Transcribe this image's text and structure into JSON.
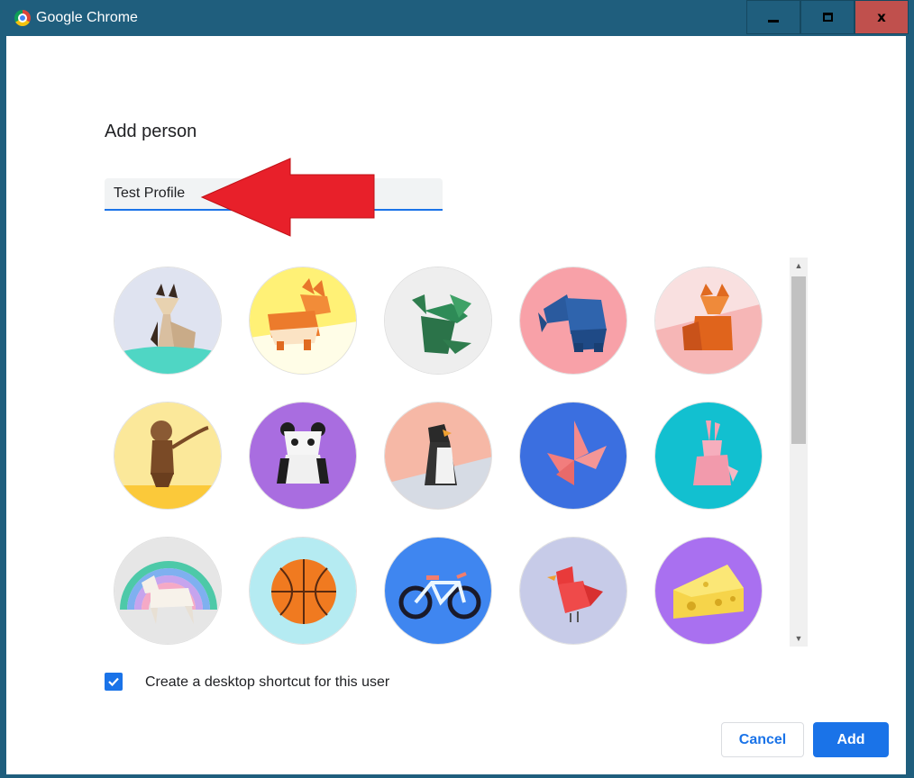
{
  "window": {
    "title": "Google Chrome",
    "icon": "chrome-icon",
    "controls": {
      "minimize": "minimize-icon",
      "maximize": "maximize-icon",
      "close_glyph": "x"
    }
  },
  "dialog": {
    "title": "Add person",
    "name_input_value": "Test Profile",
    "annotation": "red-arrow-pointing-left",
    "avatars": [
      {
        "name": "cat",
        "bg": "#dfe3f0"
      },
      {
        "name": "corgi",
        "bg": "#fff176"
      },
      {
        "name": "dragon",
        "bg": "#eeeeee"
      },
      {
        "name": "elephant",
        "bg": "#f8a1a8"
      },
      {
        "name": "fox",
        "bg": "#f9e0e0"
      },
      {
        "name": "monkey",
        "bg": "#fbe89a"
      },
      {
        "name": "panda",
        "bg": "#a96de0"
      },
      {
        "name": "penguin",
        "bg": "#f6b8a6"
      },
      {
        "name": "butterfly",
        "bg": "#3b6fe0"
      },
      {
        "name": "rabbit",
        "bg": "#12c0d0"
      },
      {
        "name": "unicorn",
        "bg": "#e6e6e6"
      },
      {
        "name": "basketball",
        "bg": "#b5ebf2"
      },
      {
        "name": "bicycle",
        "bg": "#3f86f0"
      },
      {
        "name": "bird",
        "bg": "#c7cbe8"
      },
      {
        "name": "cheese",
        "bg": "#a970f0"
      }
    ],
    "checkbox": {
      "label": "Create a desktop shortcut for this user",
      "checked": true
    },
    "buttons": {
      "cancel": "Cancel",
      "add": "Add"
    }
  },
  "colors": {
    "accent": "#1a73e8",
    "titlebar": "#1f5e7d",
    "close": "#c0504d",
    "arrow": "#e8202a"
  }
}
